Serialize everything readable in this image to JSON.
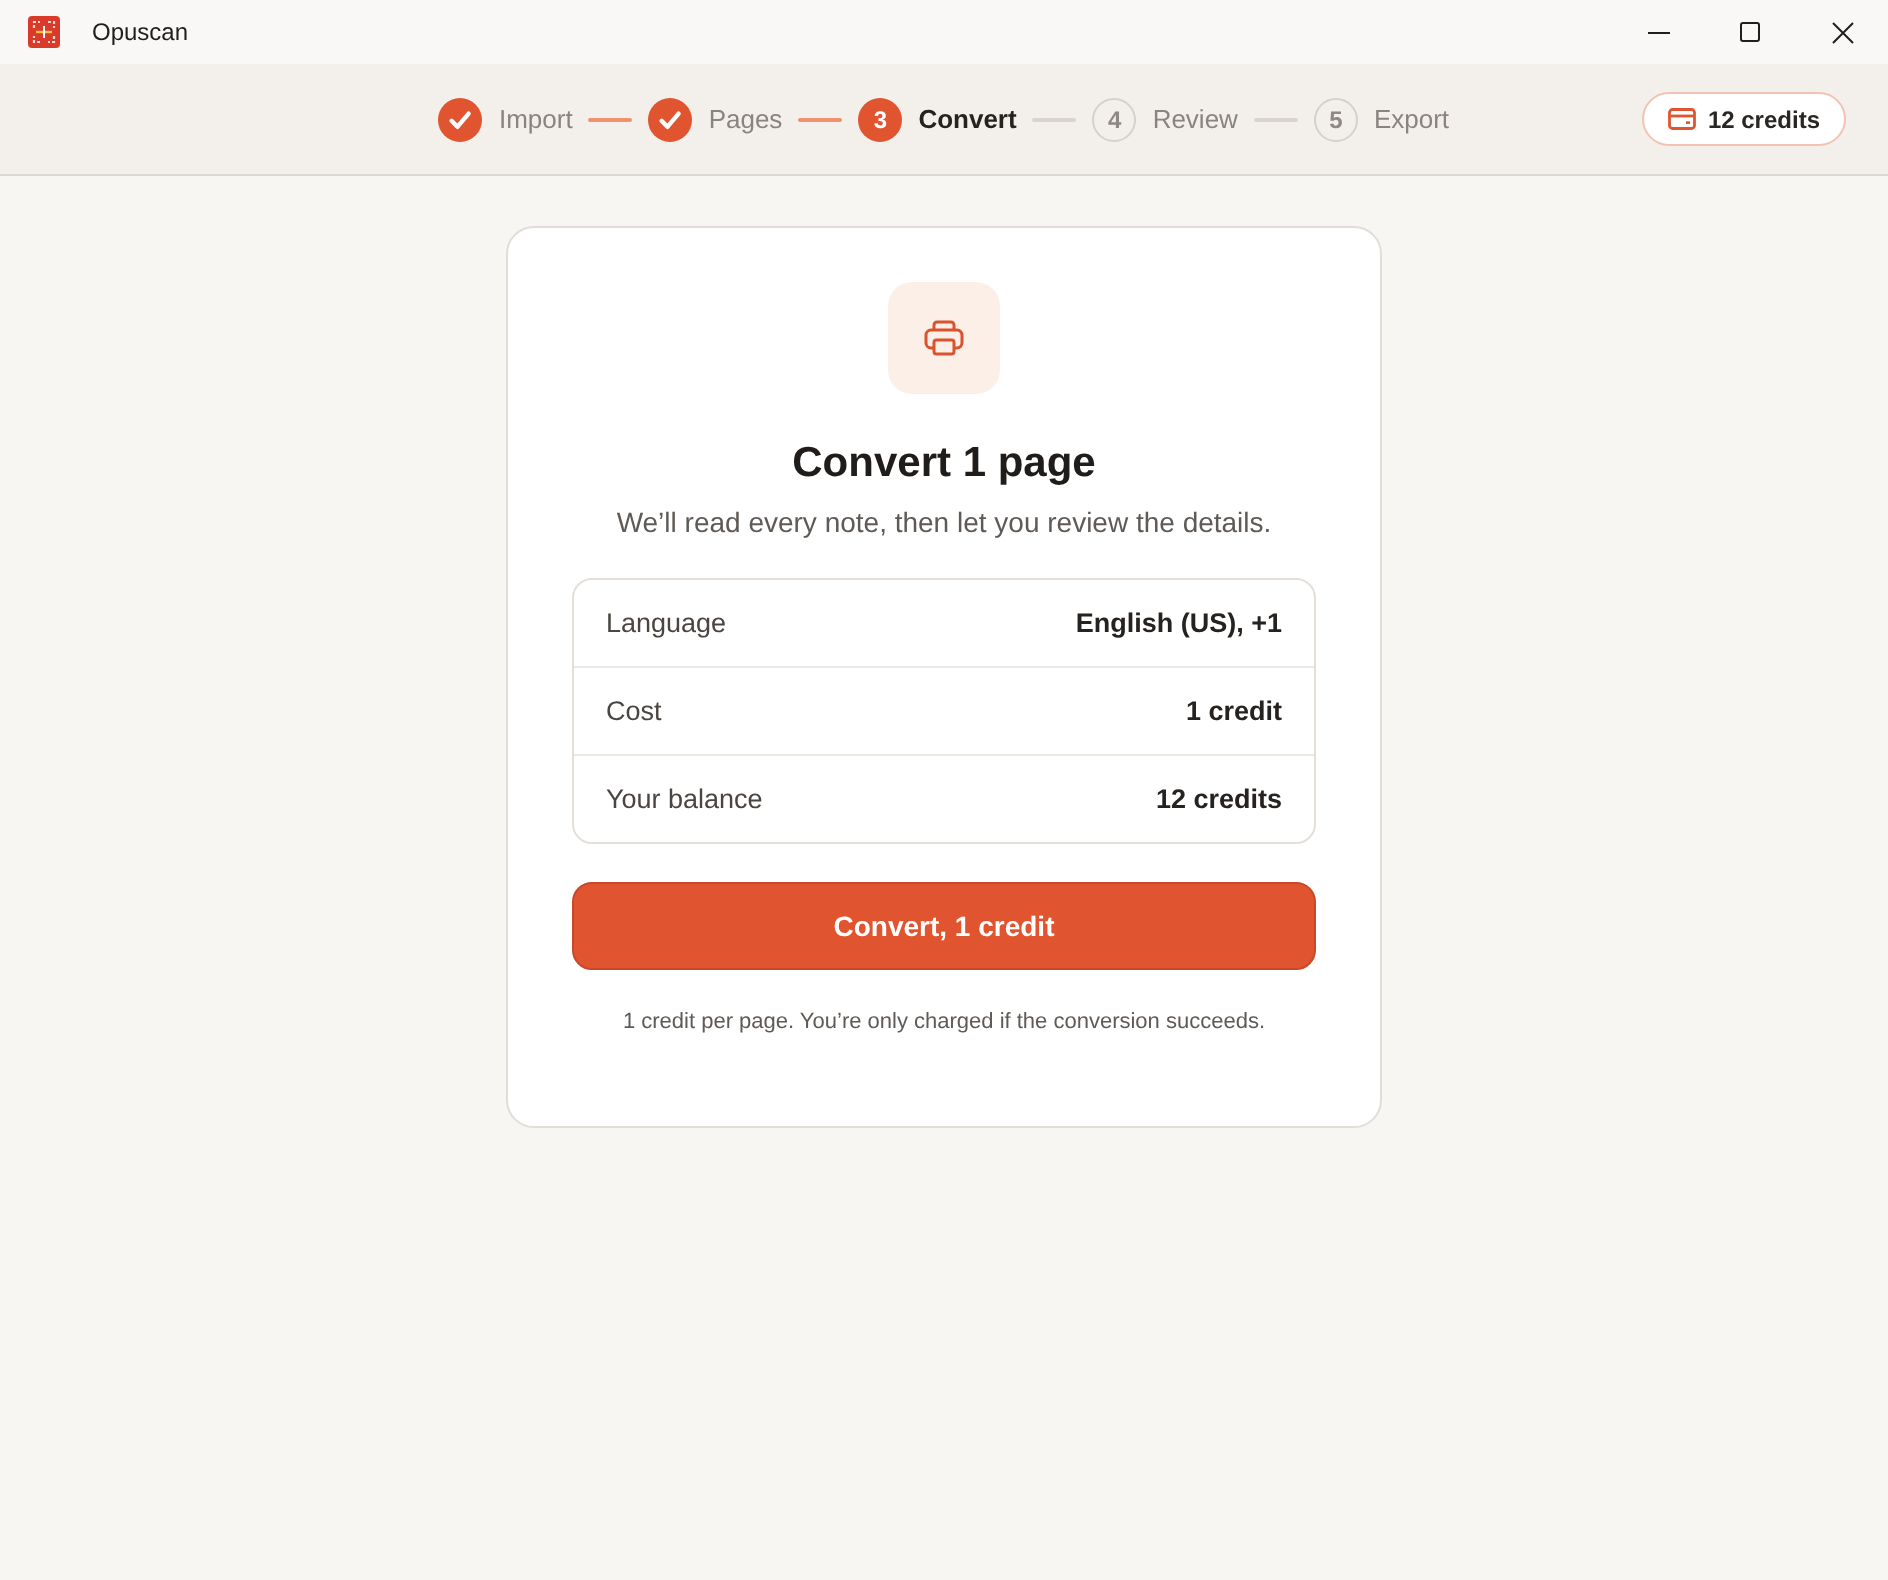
{
  "window": {
    "title": "Opuscan"
  },
  "steps": [
    {
      "label": "Import",
      "done": true,
      "selected": false
    },
    {
      "label": "Pages",
      "done": true,
      "selected": false
    },
    {
      "label": "Convert",
      "number": "3",
      "done": false,
      "selected": true
    },
    {
      "label": "Review",
      "number": "4",
      "done": false,
      "selected": false
    },
    {
      "label": "Export",
      "number": "5",
      "done": false,
      "selected": false
    }
  ],
  "credits_badge": {
    "label": "12 credits"
  },
  "card": {
    "title": "Convert 1 page",
    "subtitle": "We’ll read every note, then let you review the details.",
    "details": [
      {
        "label": "Language",
        "value": "English (US), +1"
      },
      {
        "label": "Cost",
        "value": "1 credit"
      },
      {
        "label": "Your balance",
        "value": "12 credits"
      }
    ],
    "primary_button": "Convert, 1 credit",
    "footnote": "1 credit per page. You’re only charged if the conversion succeeds."
  }
}
